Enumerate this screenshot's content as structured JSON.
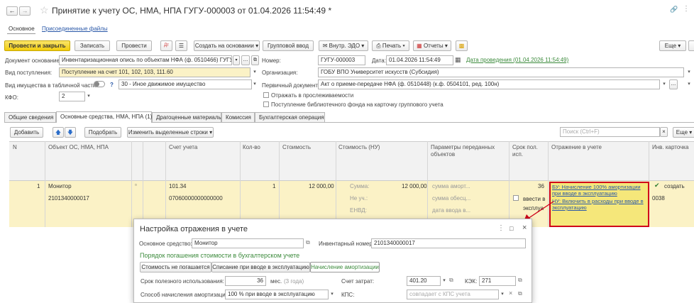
{
  "window": {
    "title": "Принятие к учету ОС, НМА, НПА ГУГУ-000003 от 01.04.2026 11:54:49 *"
  },
  "nav_tabs": {
    "main": "Основное",
    "files": "Присоединенные файлы"
  },
  "toolbar": {
    "post_close": "Провести и закрыть",
    "save": "Записать",
    "post": "Провести",
    "create_based": "Создать на основании",
    "group_input": "Групповой ввод",
    "edo": "Внутр. ЭДО",
    "print": "Печать",
    "reports": "Отчеты",
    "more": "Еще"
  },
  "form": {
    "doc_basis_label": "Документ основание:",
    "doc_basis_value": "Инвентаризационная опись по объектам НФА (ф. 0510466) ГУГУ-000003...",
    "income_type_label": "Вид поступления:",
    "income_type_value": "Поступление на счет 101, 102, 103, 111.60",
    "property_type_label": "Вид имущества в табличной части:",
    "property_type_value": "30 - Иное движимое имущество",
    "kfo_label": "КФО:",
    "kfo_value": "2",
    "number_label": "Номер:",
    "number_value": "ГУГУ-000003",
    "date_label": "Дата:",
    "date_value": "01.04.2026 11:54:49",
    "posting_date_link": "Дата проведения (01.04.2026 11:54:49)",
    "org_label": "Организация:",
    "org_value": "ГОБУ ВПО Университет искусств (Субсидия)",
    "primary_doc_label": "Первичный документ:",
    "primary_doc_value": "Акт о приеме-передаче НФА (ф. 0510448) (к.ф. 0504101, ред. 100н)",
    "traceability_label": "Отражать в прослеживаемости",
    "library_label": "Поступление библиотечного фонда на карточку группового учета",
    "help_mark": "?"
  },
  "doc_tabs": [
    "Общие сведения",
    "Основные средства, НМА, НПА (1)",
    "Драгоценные материалы",
    "Комиссия",
    "Бухгалтерская операция"
  ],
  "table_toolbar": {
    "add": "Добавить",
    "pick": "Подобрать",
    "change_rows": "Изменить выделенные строки",
    "search_placeholder": "Поиск (Ctrl+F)",
    "more": "Еще"
  },
  "table": {
    "headers": [
      "N",
      "Объект ОС, НМА, НПА",
      "Счет учета",
      "Кол-во",
      "Стоимость",
      "Стоимость (НУ)",
      "Параметры переданных объектов",
      "Срок пол. исп.",
      "Отражение в учете",
      "Инв. карточка"
    ],
    "row": {
      "n": "1",
      "object": "Монитор",
      "object_code": "2101340000017",
      "account": "101.34",
      "account_code": "07060000000000000",
      "qty": "1",
      "cost": "12 000,00",
      "nu_sum_label": "Сумма:",
      "nu_sum_value": "12 000,00",
      "nu_not_acc_label": "Не уч.:",
      "nu_envd_label": "ЕНВД:",
      "param_amort": "сумма аморт...",
      "param_obesc": "сумма обесц...",
      "param_date": "дата ввода в...",
      "useful_life": "36",
      "commission_label": "ввести в эксплуа",
      "reflect_bu": "БУ: Начисление 100% амортизации при вводе в эксплуатацию",
      "reflect_nu": "НУ: Включить в расходы при вводе в эксплуатацию",
      "inv_card_create": "создать",
      "inv_card_num": "0038"
    }
  },
  "dialog": {
    "title": "Настройка отражения в учете",
    "asset_label": "Основное средство:",
    "asset_value": "Монитор",
    "inv_label": "Инвентарный номер:",
    "inv_value": "2101340000017",
    "section_title": "Порядок погашения стоимости в бухгалтерском учете",
    "modes": [
      "Стоимость не погашается",
      "Списание при вводе в эксплуатацию",
      "Начисление амортизации"
    ],
    "life_label": "Срок полезного использования:",
    "life_value": "36",
    "life_unit": "мес.",
    "life_years": "(3 года)",
    "cost_account_label": "Счет затрат:",
    "cost_account_value": "401.20",
    "kek_label": "КЭК:",
    "kek_value": "271",
    "method_label": "Способ начисления амортизации:",
    "method_value": "100 % при вводе в эксплуатацию",
    "kps_label": "КПС:",
    "kps_placeholder": "совпадает с КПС учета"
  },
  "colors": {
    "accent": "#f5d426",
    "row_highlight": "#fbf2c6",
    "link": "#2a58a8",
    "red": "#d0021b",
    "green": "#3b8a3b"
  }
}
